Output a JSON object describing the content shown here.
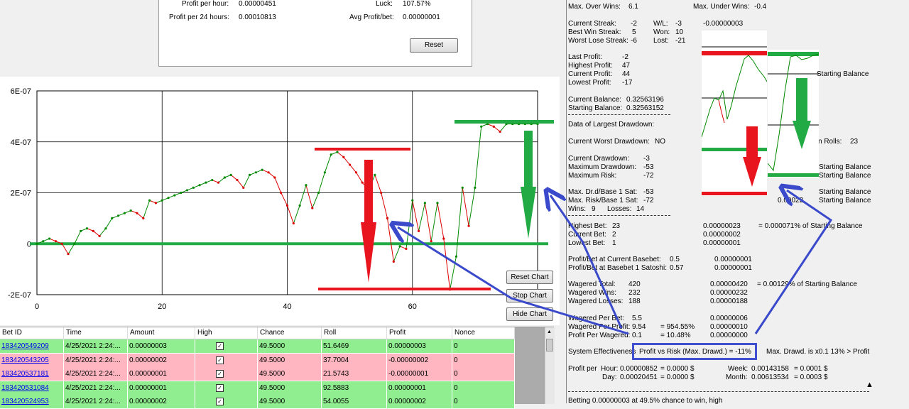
{
  "stats": {
    "profit_hour_label": "Profit per hour:",
    "profit_hour_value": "0.00000451",
    "profit_24_label": "Profit per 24 hours:",
    "profit_24_value": "0.00010813",
    "luck_label": "Luck:",
    "luck_value": "107.57%",
    "avg_label": "Avg Profit/bet:",
    "avg_value": "0.00000001",
    "reset_label": "Reset"
  },
  "chart_buttons": {
    "reset": "Reset Chart",
    "stop": "Stop Chart",
    "hide": "Hide Chart"
  },
  "chart_data": {
    "type": "line",
    "ylim": [
      -2e-07,
      6e-07
    ],
    "xlim": [
      0,
      80
    ],
    "yticks": [
      "6E-07",
      "4E-07",
      "2E-07",
      "0",
      "-2E-07"
    ],
    "xticks": [
      "0",
      "20",
      "40",
      "60"
    ],
    "x": [
      0,
      1,
      2,
      3,
      4,
      5,
      6,
      7,
      8,
      9,
      10,
      11,
      12,
      13,
      14,
      15,
      16,
      17,
      18,
      19,
      20,
      21,
      22,
      23,
      24,
      25,
      26,
      27,
      28,
      29,
      30,
      31,
      32,
      33,
      34,
      35,
      36,
      37,
      38,
      39,
      40,
      41,
      42,
      43,
      44,
      45,
      46,
      47,
      48,
      49,
      50,
      51,
      52,
      53,
      54,
      55,
      56,
      57,
      58,
      59,
      60,
      61,
      62,
      63,
      64,
      65,
      66,
      67,
      68,
      69,
      70,
      71,
      72,
      73,
      74,
      75,
      76,
      77,
      78,
      79,
      80
    ],
    "y": [
      0,
      1e-08,
      2e-08,
      1e-08,
      0,
      -4e-08,
      0,
      5e-08,
      6e-08,
      5e-08,
      3e-08,
      6e-08,
      1e-07,
      1.1e-07,
      1.2e-07,
      1.3e-07,
      1.2e-07,
      1e-07,
      1.7e-07,
      1.6e-07,
      1.7e-07,
      1.8e-07,
      1.9e-07,
      2e-07,
      2.1e-07,
      2.2e-07,
      2.3e-07,
      2.4e-07,
      2.5e-07,
      2.4e-07,
      2.6e-07,
      2.7e-07,
      2.5e-07,
      2.2e-07,
      2.7e-07,
      2.8e-07,
      2.9e-07,
      2.8e-07,
      2.6e-07,
      2e-07,
      1.5e-07,
      8e-08,
      1.5e-07,
      2.3e-07,
      1.4e-07,
      2e-07,
      2.8e-07,
      3.5e-07,
      3.6e-07,
      3.4e-07,
      3.1e-07,
      2.8e-07,
      2.4e-07,
      2.1e-07,
      2.7e-07,
      2e-07,
      1e-07,
      -7e-08,
      -1e-08,
      -2e-08,
      1.7e-07,
      5e-08,
      1.6e-07,
      1e-08,
      1.6e-07,
      2e-08,
      -1.8e-07,
      -5e-08,
      2.2e-07,
      7e-08,
      2.2e-07,
      4.6e-07,
      4.7e-07,
      4.6e-07,
      4.4e-07,
      4.7e-07,
      4.7e-07,
      4.7e-07,
      4.7e-07,
      4.7e-07,
      4.7e-07
    ],
    "colors": {
      "up": "#008800",
      "down": "#dd0000",
      "zero_line": "#22aa44",
      "grid": "#000000"
    }
  },
  "table": {
    "columns": [
      "Bet ID",
      "Time",
      "Amount",
      "High",
      "Chance",
      "Roll",
      "Profit",
      "Nonce"
    ],
    "rows": [
      {
        "id": "183420549209",
        "time": "4/25/2021 2:24:...",
        "amount": "0.00000003",
        "high": "✓",
        "chance": "49.5000",
        "roll": "51.6469",
        "profit": "0.00000003",
        "nonce": "0",
        "win": true
      },
      {
        "id": "183420543205",
        "time": "4/25/2021 2:24:...",
        "amount": "0.00000002",
        "high": "✓",
        "chance": "49.5000",
        "roll": "37.7004",
        "profit": "-0.00000002",
        "nonce": "0",
        "win": false
      },
      {
        "id": "183420537181",
        "time": "4/25/2021 2:24:...",
        "amount": "0.00000001",
        "high": "✓",
        "chance": "49.5000",
        "roll": "21.5743",
        "profit": "-0.00000001",
        "nonce": "0",
        "win": false
      },
      {
        "id": "183420531084",
        "time": "4/25/2021 2:24:...",
        "amount": "0.00000001",
        "high": "✓",
        "chance": "49.5000",
        "roll": "92.5883",
        "profit": "0.00000001",
        "nonce": "0",
        "win": true
      },
      {
        "id": "183420524953",
        "time": "4/25/2021 2:24:...",
        "amount": "0.00000002",
        "high": "✓",
        "chance": "49.5000",
        "roll": "54.0055",
        "profit": "0.00000002",
        "nonce": "0",
        "win": true
      }
    ]
  },
  "right": {
    "max_over_wins_label": "Max. Over Wins:",
    "max_over_wins_value": "6.1",
    "max_under_wins_label": "Max. Under Wins:",
    "max_under_wins_value": "-0.4",
    "current_streak_label": "Current Streak:",
    "current_streak_value": "-2",
    "wl_label": "W/L:",
    "wl_value": "-3",
    "wl_amount": "-0.00000003",
    "best_win_label": "Best Win Streak:",
    "best_win_value": "5",
    "won_label": "Won:",
    "won_value": "10",
    "worst_lose_label": "Worst Lose Streak:",
    "worst_lose_value": "-6",
    "lost_label": "Lost:",
    "lost_value": "-21",
    "last_profit_label": "Last Profit:",
    "last_profit_value": "-2",
    "highest_profit_label": "Highest Profit:",
    "highest_profit_value": "47",
    "current_profit_label": "Current Profit:",
    "current_profit_value": "44",
    "lowest_profit_label": "Lowest Profit:",
    "lowest_profit_value": "-17",
    "current_balance_label": "Current Balance:",
    "current_balance_value": "0.32563196",
    "starting_balance_label": "Starting Balance:",
    "starting_balance_value": "0.32563152",
    "largest_drawdown_label": "Data of Largest Drawdown:",
    "current_worst_dd_label": "Current Worst Drawdown:",
    "current_worst_dd_value": "NO",
    "rolls_label": "n Rolls:",
    "rolls_value": "23",
    "current_dd_label": "Current Drawdown:",
    "current_dd_value": "-3",
    "max_dd_label": "Maximum Drawdown:",
    "max_dd_value": "-53",
    "max_risk_label": "Maximum Risk:",
    "max_risk_value": "-72",
    "max_drd_label": "Max. Dr.d/Base 1 Sat:",
    "max_drd_value": "-53",
    "max_risk_base_label": "Max. Risk/Base 1 Sat:",
    "max_risk_base_value": "-72",
    "wins_label": "Wins:",
    "wins_value": "9",
    "losses_label": "Losses:",
    "losses_value": "14",
    "starting_balance_text": "Starting Balance",
    "sb_pct_1": "0.00022",
    "highest_bet_label": "Highest Bet:",
    "highest_bet_value": "23",
    "highest_bet_amount": "0.00000023",
    "highest_bet_pct": "= 0.000071% of Starting Balance",
    "current_bet_label": "Current Bet:",
    "current_bet_value": "2",
    "current_bet_amount": "0.00000002",
    "lowest_bet_label": "Lowest Bet:",
    "lowest_bet_value": "1",
    "lowest_bet_amount": "0.00000001",
    "pb_current_label": "Profit/Bet at Current Basebet:",
    "pb_current_value": "0.5",
    "pb_current_amount": "0.00000001",
    "pb_sat_label": "Profit/Bet at Basebet 1 Satoshi:",
    "pb_sat_value": "0.57",
    "pb_sat_amount": "0.00000001",
    "wagered_total_label": "Wagered Total:",
    "wagered_total_value": "420",
    "wagered_total_amount": "0.00000420",
    "wagered_total_pct": "= 0.00129% of Starting Balance",
    "wagered_wins_label": "Wagered Wins:",
    "wagered_wins_value": "232",
    "wagered_wins_amount": "0.00000232",
    "wagered_losses_label": "Wagered Losses:",
    "wagered_losses_value": "188",
    "wagered_losses_amount": "0.00000188",
    "wagered_per_bet_label": "Wagered Per Bet:",
    "wagered_per_bet_value": "5.5",
    "wagered_per_bet_amount": "0.00000006",
    "wagered_per_profit_label": "Wagered Per Profit:",
    "wagered_per_profit_value": "9.54",
    "wagered_per_profit_pct": "= 954.55%",
    "wagered_per_profit_amount": "0.00000010",
    "profit_per_wagered_label": "Profit Per Wagered:",
    "profit_per_wagered_value": "0.1",
    "profit_per_wagered_pct": "= 10.48%",
    "profit_per_wagered_amount": "0.00000000",
    "sys_eff_label": "System Effectiveness",
    "sys_eff_value": "Profit vs Risk (Max. Drawd.)  = -11%",
    "max_drawd_text": "Max. Drawd. is x0.1  13%  >  Profit",
    "profit_per_label": "Profit per",
    "hour_label": "Hour:",
    "hour_value": "0.00000852",
    "hour_usd": "= 0.0000 $",
    "day_label": "Day:",
    "day_value": "0.00020451",
    "day_usd": "= 0.0000 $",
    "week_label": "Week:",
    "week_value": "0.00143158",
    "week_usd": "= 0.0001 $",
    "month_label": "Month:",
    "month_value": "0.00613534",
    "month_usd": "= 0.0003 $",
    "betting_text": "Betting 0.00000003 at 49.5% chance to win, high"
  },
  "colors": {
    "win_row": "#90ee90",
    "loss_row": "#ffb6c1",
    "arrow_blue": "#3a4acb",
    "arrow_red": "#e8141e",
    "arrow_green": "#22aa44"
  }
}
